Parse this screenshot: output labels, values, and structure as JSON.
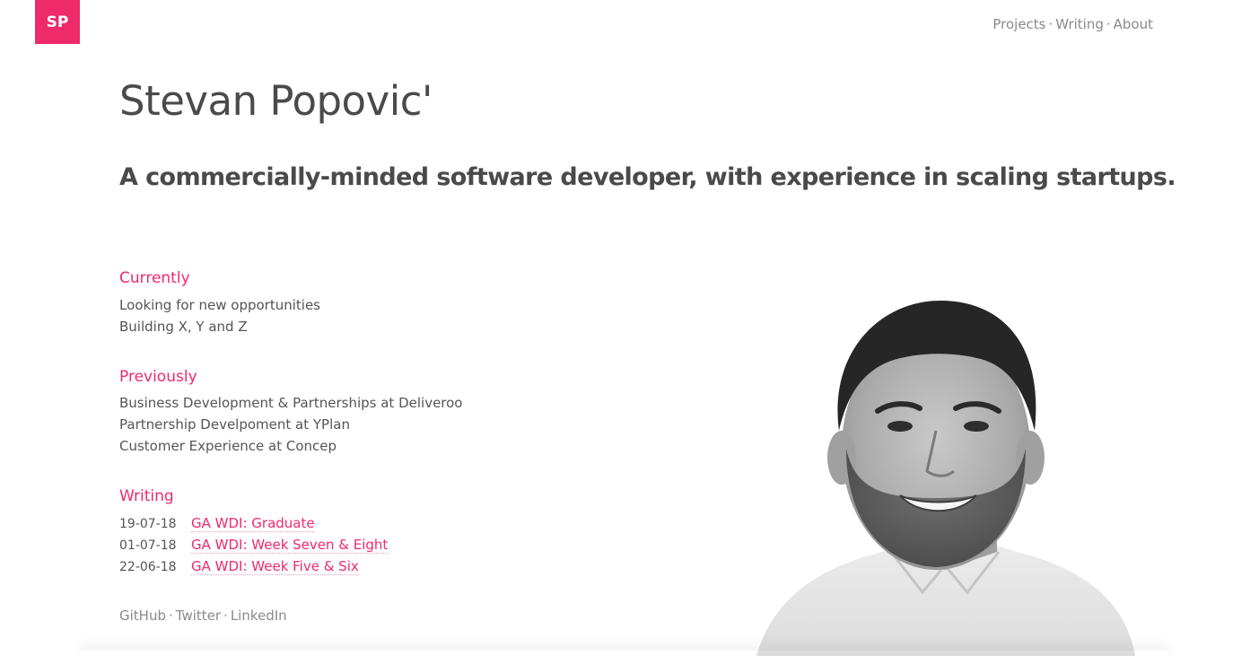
{
  "logo": {
    "text": "SP"
  },
  "nav": {
    "items": [
      "Projects",
      "Writing",
      "About"
    ],
    "separator": "·"
  },
  "hero": {
    "name": "Stevan Popovic'",
    "tagline": "A commercially-minded software developer, with experience in scaling startups."
  },
  "currently": {
    "title": "Currently",
    "lines": [
      "Looking for new opportunities",
      "Building X, Y and Z"
    ]
  },
  "previously": {
    "title": "Previously",
    "lines": [
      "Business Development & Partnerships at Deliveroo",
      "Partnership Develpoment at YPlan",
      "Customer Experience at Concep"
    ]
  },
  "writing": {
    "title": "Writing",
    "posts": [
      {
        "date": "19-07-18",
        "title": "GA WDI: Graduate"
      },
      {
        "date": "01-07-18",
        "title": "GA WDI: Week Seven & Eight"
      },
      {
        "date": "22-06-18",
        "title": "GA WDI: Week Five & Six"
      }
    ]
  },
  "social": {
    "items": [
      "GitHub",
      "Twitter",
      "LinkedIn"
    ],
    "separator": "·"
  },
  "colors": {
    "accent": "#ee2a6a",
    "text": "#4a4a4a",
    "muted": "#8a8a8a"
  }
}
